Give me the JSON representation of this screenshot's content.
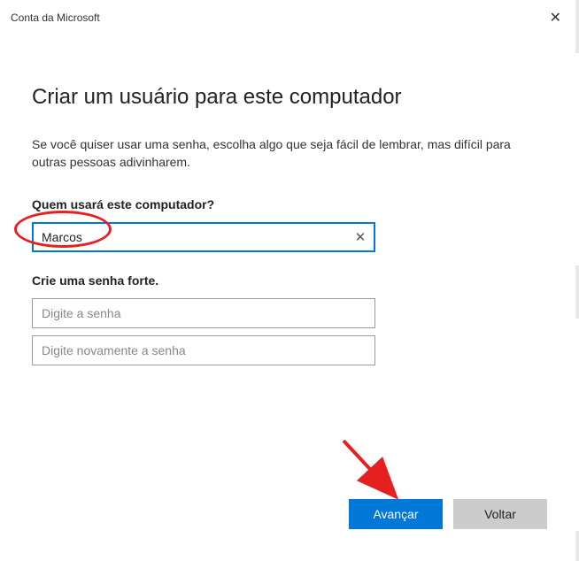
{
  "window": {
    "title": "Conta da Microsoft",
    "close_icon": "✕"
  },
  "page": {
    "heading": "Criar um usuário para este computador",
    "description": "Se você quiser usar uma senha, escolha algo que seja fácil de lembrar, mas difícil para outras pessoas adivinharem."
  },
  "username": {
    "label": "Quem usará este computador?",
    "value": "Marcos",
    "clear_icon": "✕"
  },
  "password": {
    "label": "Crie uma senha forte.",
    "placeholder1": "Digite a senha",
    "placeholder2": "Digite novamente a senha"
  },
  "footer": {
    "next": "Avançar",
    "back": "Voltar"
  },
  "colors": {
    "accent": "#0078d7",
    "annotation": "#e62020"
  }
}
